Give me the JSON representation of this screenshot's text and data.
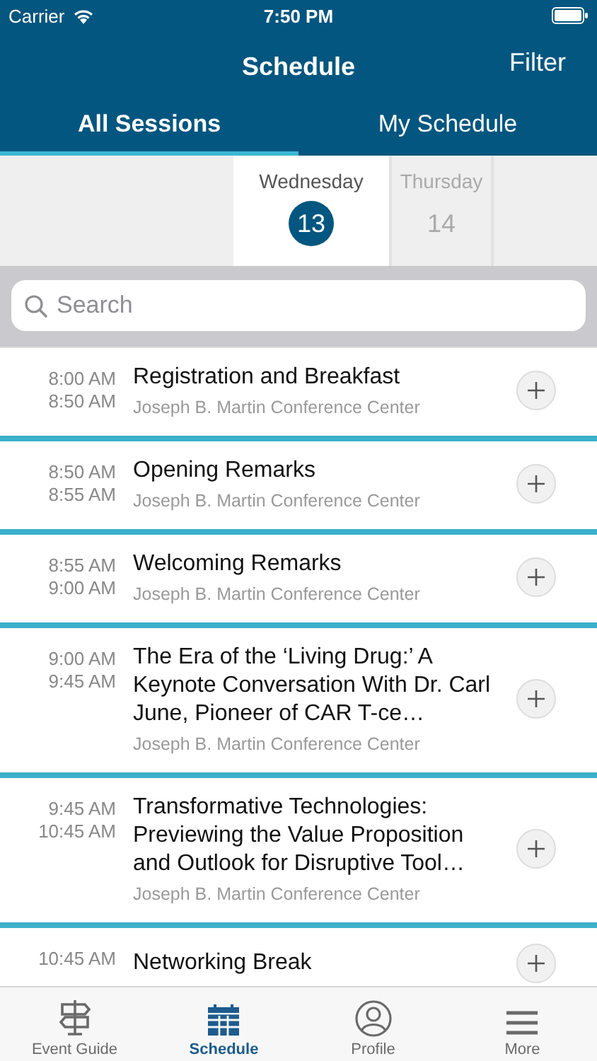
{
  "status_bar": {
    "carrier": "Carrier",
    "time": "7:50 PM"
  },
  "nav": {
    "title": "Schedule",
    "action": "Filter"
  },
  "tabs": [
    {
      "label": "All Sessions",
      "selected": true
    },
    {
      "label": "My Schedule",
      "selected": false
    }
  ],
  "days": [
    {
      "weekday": "Wednesday",
      "date": "13",
      "selected": true
    },
    {
      "weekday": "Thursday",
      "date": "14",
      "selected": false
    }
  ],
  "search": {
    "placeholder": "Search"
  },
  "sessions": [
    {
      "start": "8:00 AM",
      "end": "8:50 AM",
      "title": "Registration and Breakfast",
      "location": "Joseph B. Martin Conference Center"
    },
    {
      "start": "8:50 AM",
      "end": "8:55 AM",
      "title": "Opening Remarks",
      "location": "Joseph B. Martin Conference Center"
    },
    {
      "start": "8:55 AM",
      "end": "9:00 AM",
      "title": "Welcoming Remarks",
      "location": "Joseph B. Martin Conference Center"
    },
    {
      "start": "9:00 AM",
      "end": "9:45 AM",
      "title": "The Era of the ‘Living Drug:’ A Keynote Conversation With Dr. Carl June, Pioneer of CAR T-ce…",
      "location": "Joseph B. Martin Conference Center"
    },
    {
      "start": "9:45 AM",
      "end": "10:45 AM",
      "title": "Transformative Technologies: Previewing the Value Proposition and Outlook for Disruptive Tool…",
      "location": "Joseph B. Martin Conference Center"
    },
    {
      "start": "10:45 AM",
      "title": "Networking Break"
    }
  ],
  "tab_bar": [
    {
      "label": "Event Guide",
      "kind": "signpost",
      "selected": false
    },
    {
      "label": "Schedule",
      "kind": "calendar",
      "selected": true
    },
    {
      "label": "Profile",
      "kind": "person",
      "selected": false
    },
    {
      "label": "More",
      "kind": "menu",
      "selected": false
    }
  ]
}
